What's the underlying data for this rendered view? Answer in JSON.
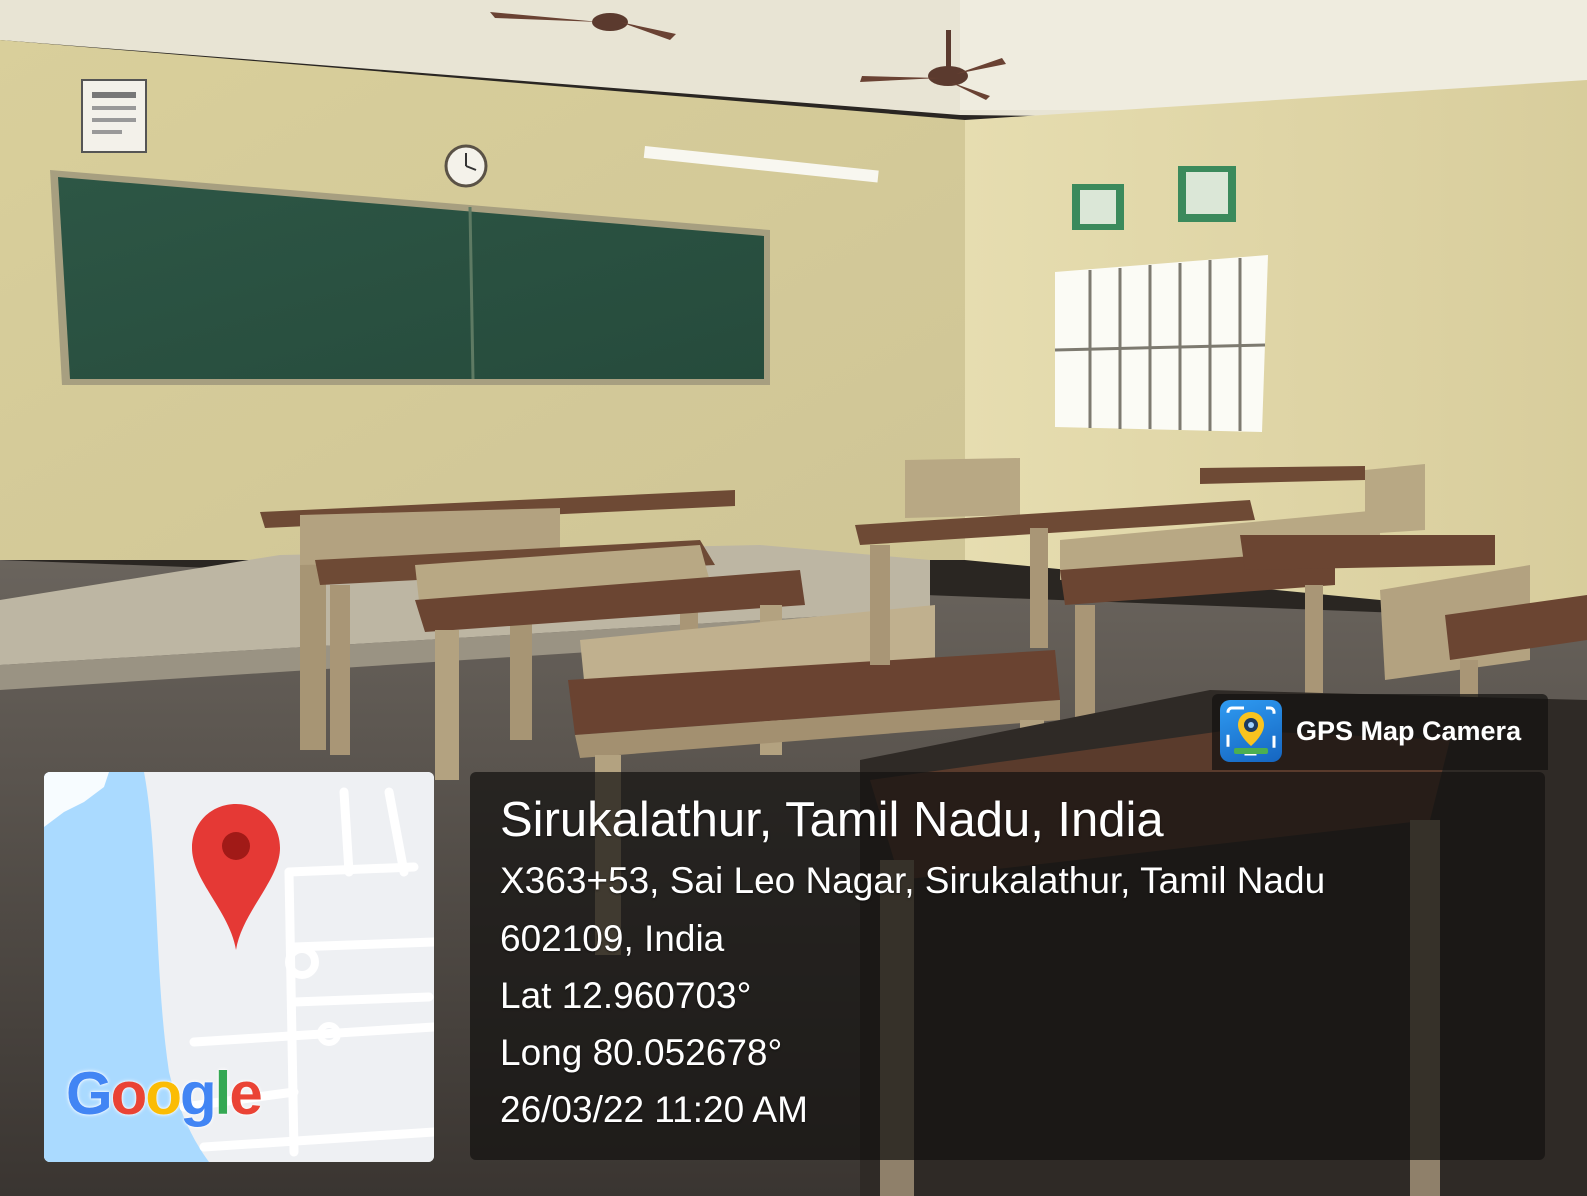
{
  "watermark": {
    "app_name": "GPS Map Camera",
    "location_title": "Sirukalathur, Tamil Nadu, India",
    "address_line1": "X363+53, Sai Leo Nagar, Sirukalathur, Tamil Nadu",
    "address_line2": "602109, India",
    "latitude": "Lat 12.960703°",
    "longitude": "Long 80.052678°",
    "timestamp": "26/03/22 11:20 AM"
  },
  "map": {
    "logo_text": "Google",
    "logo_colors": [
      "#4285F4",
      "#EA4335",
      "#FBBC05",
      "#4285F4",
      "#34A853",
      "#EA4335"
    ],
    "pin_color": "#E53935",
    "water_color": "#AADAFF",
    "road_color": "#FFFFFF",
    "land_color": "#EEF0F3"
  },
  "colors": {
    "wall": "#E2D9A8",
    "chalkboard": "#2E5A45",
    "desk_top": "#6E4A35",
    "desk_frame": "#BFAF92",
    "floor": "#5D5752",
    "panel_bg": "rgba(20,18,17,0.72)"
  },
  "icons": {
    "app": "camera-location-icon",
    "pin": "map-pin-icon"
  }
}
